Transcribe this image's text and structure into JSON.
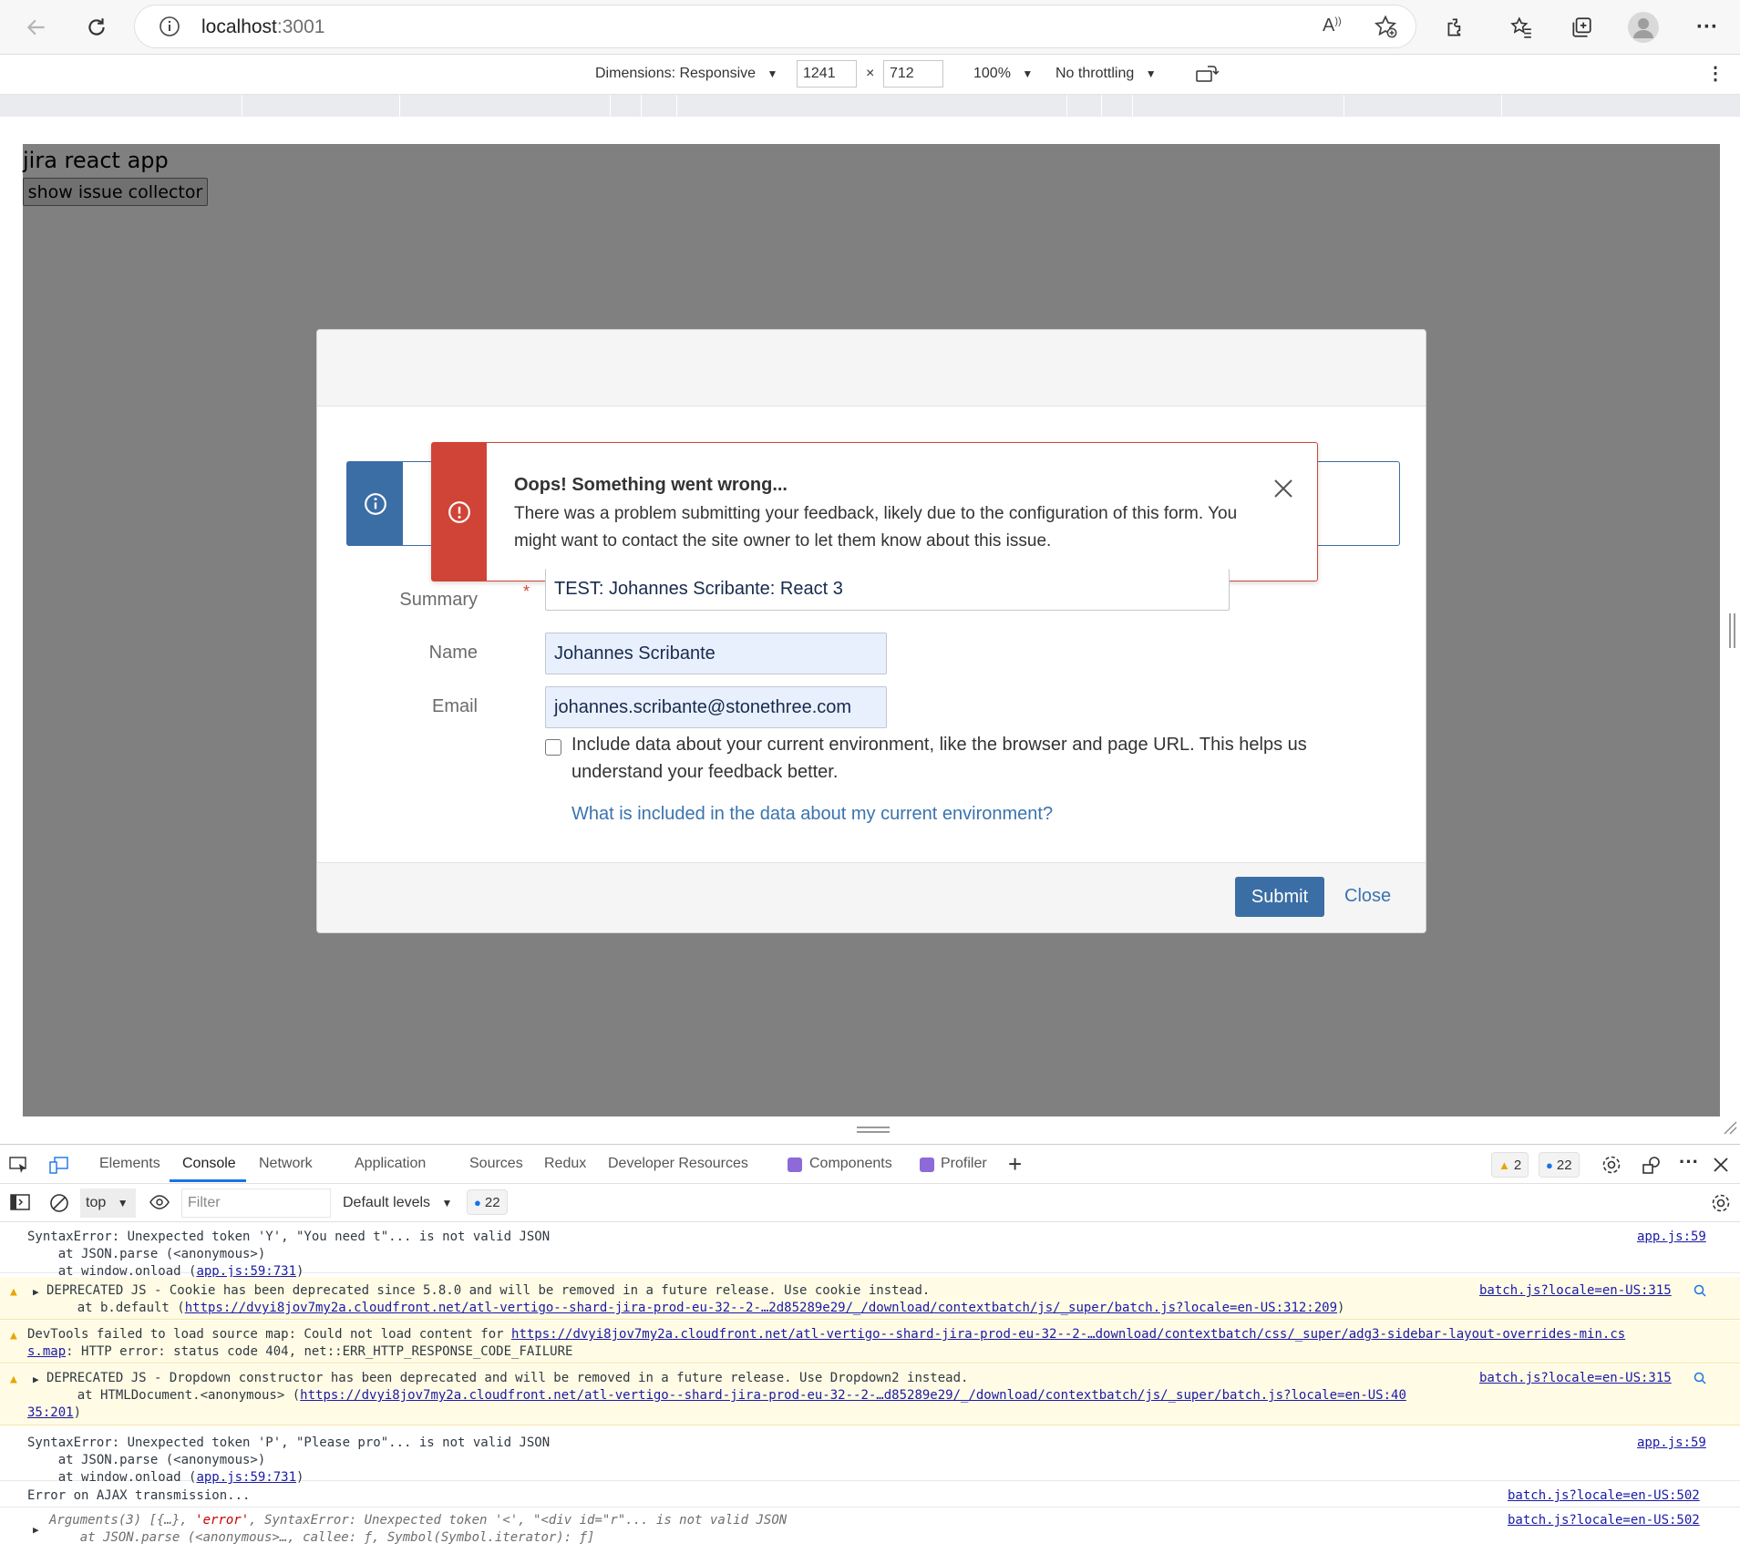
{
  "browser": {
    "url_host": "localhost",
    "url_port": ":3001"
  },
  "device_toolbar": {
    "dimensions_label": "Dimensions: Responsive",
    "width": "1241",
    "times": "×",
    "height": "712",
    "zoom": "100%",
    "throttling": "No throttling"
  },
  "page": {
    "title": "jira react app",
    "show_button": "show issue collector"
  },
  "error": {
    "title": "Oops! Something went wrong...",
    "message": "There was a problem submitting your feedback, likely due to the configuration of this form. You might want to contact the site owner to let them know about this issue."
  },
  "form": {
    "summary_label": "Summary",
    "required_mark": "*",
    "summary_value": "TEST: Johannes Scribante: React 3",
    "name_label": "Name",
    "name_value": "Johannes Scribante",
    "email_label": "Email",
    "email_value": "johannes.scribante@stonethree.com",
    "env_checkbox_text": "Include data about your current environment, like the browser and page URL. This helps us understand your feedback better.",
    "env_link": "What is included in the data about my current environment?",
    "submit": "Submit",
    "close": "Close"
  },
  "devtools": {
    "tabs": [
      "Elements",
      "Console",
      "Network",
      "Application",
      "Sources",
      "Redux",
      "Developer Resources",
      "Components",
      "Profiler"
    ],
    "warn_count": "2",
    "msg_count": "22",
    "context": "top",
    "filter_placeholder": "Filter",
    "levels": "Default levels",
    "toolbar_msg_count": "22"
  },
  "console": {
    "r1_l1": "SyntaxError: Unexpected token 'Y', \"You need t\"... is not valid JSON",
    "r1_l2": "    at JSON.parse (<anonymous>)",
    "r1_l3a": "    at window.onload (",
    "r1_l3b": "app.js:59:731",
    "r1_l3c": ")",
    "r1_src": "app.js:59",
    "r2_l1": "DEPRECATED JS - Cookie has been deprecated since 5.8.0 and will be removed in a future release. Use cookie instead.",
    "r2_l2a": "    at b.default (",
    "r2_l2b": "https://dvyi8jov7my2a.cloudfront.net/atl-vertigo--shard-jira-prod-eu-32--2-…2d85289e29/_/download/contextbatch/js/_super/batch.js?locale=en-US:312:209",
    "r2_l2c": ")",
    "r2_src": "batch.js?locale=en-US:315",
    "r3_l1a": "DevTools failed to load source map: Could not load content for ",
    "r3_l1b": "https://dvyi8jov7my2a.cloudfront.net/atl-vertigo--shard-jira-prod-eu-32--2-…download/contextbatch/css/_super/adg3-sidebar-layout-overrides-min.cs",
    "r3_l2a": "s.map",
    "r3_l2b": ": HTTP error: status code 404, net::ERR_HTTP_RESPONSE_CODE_FAILURE",
    "r4_l1": "DEPRECATED JS - Dropdown constructor has been deprecated and will be removed in a future release. Use Dropdown2 instead.",
    "r4_l2a": "    at HTMLDocument.<anonymous> (",
    "r4_l2b": "https://dvyi8jov7my2a.cloudfront.net/atl-vertigo--shard-jira-prod-eu-32--2-…d85289e29/_/download/contextbatch/js/_super/batch.js?locale=en-US:40",
    "r4_l3a": "35:201",
    "r4_l3b": ")",
    "r4_src": "batch.js?locale=en-US:315",
    "r5_l1": "SyntaxError: Unexpected token 'P', \"Please pro\"... is not valid JSON",
    "r5_l2": "    at JSON.parse (<anonymous>)",
    "r5_l3a": "    at window.onload (",
    "r5_l3b": "app.js:59:731",
    "r5_l3c": ")",
    "r5_src": "app.js:59",
    "r6_l1": "Error on AJAX transmission...",
    "r6_src": "batch.js?locale=en-US:502",
    "r7_l1a": "Arguments(3) [{…}, ",
    "r7_l1b": "'error'",
    "r7_l1c": ", SyntaxError: Unexpected token '<', \"<div id=\"r\"... is not valid JSON",
    "r7_l2": "    at JSON.parse (<anonymous>…, callee: ƒ, Symbol(Symbol.iterator): ƒ]",
    "r7_src": "batch.js?locale=en-US:502"
  }
}
